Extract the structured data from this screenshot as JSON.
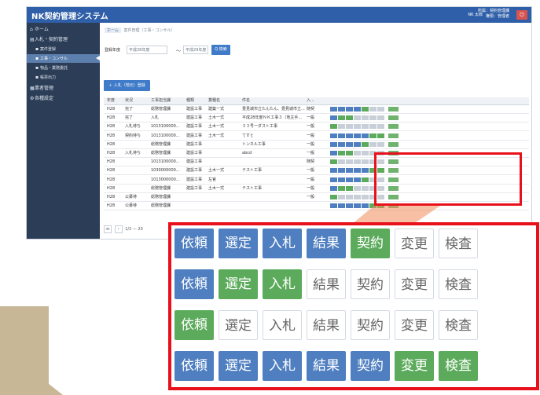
{
  "app": {
    "title": "NK契約管理システム",
    "user": "NK 太郎",
    "role_line1": "所属：契約管理課",
    "role_line2": "権限：管理者",
    "logout_label": "⏻"
  },
  "sidebar": {
    "items": [
      {
        "label": "ホーム",
        "icon": "home-icon"
      },
      {
        "label": "入札・契約管理",
        "icon": "list-icon"
      },
      {
        "label": "案件登録",
        "icon": "form-icon",
        "sub": true
      },
      {
        "label": "工事・コンサル",
        "icon": "form-icon",
        "sub": true,
        "active": true
      },
      {
        "label": "物品・業務委託",
        "icon": "form-icon",
        "sub": true
      },
      {
        "label": "帳票出力",
        "icon": "print-icon",
        "sub": true
      },
      {
        "label": "業者管理",
        "icon": "people-icon"
      },
      {
        "label": "各種設定",
        "icon": "gear-icon"
      }
    ]
  },
  "breadcrumb": {
    "home": "ホーム",
    "current": "案件管理（工事・コンサル）"
  },
  "filter": {
    "label": "登録年度",
    "from_placeholder": "平成28年度",
    "to_placeholder": "平成29年度",
    "separator": "〜",
    "search_label": "Q 検索"
  },
  "new_button": "＋ 入札（地元）登録",
  "table": {
    "headers": [
      "年度",
      "状況",
      "工事担当課",
      "種類",
      "業種名",
      "件名",
      "入...",
      ""
    ],
    "rows": [
      [
        "H28",
        "完了",
        "総務管理課",
        "建設工事",
        "建築一式",
        "豊見城市立たんたん、豊見城市立...",
        "随契"
      ],
      [
        "H28",
        "完了",
        "入札",
        "建設工事",
        "土木一式",
        "平成28年度ＮＫ工事３（地主手...",
        "一般"
      ],
      [
        "H28",
        "入札待ち",
        "1013100000...",
        "建設工事",
        "土木一式",
        "３３号ーダスト工事",
        "一般"
      ],
      [
        "H28",
        "契約待ち",
        "1013100000...",
        "建設工事",
        "土木一式",
        "てすと",
        "一般"
      ],
      [
        "H28",
        "",
        "総務管理課",
        "建設工事",
        "",
        "トンネル工事",
        "一般"
      ],
      [
        "H28",
        "入札待ち",
        "総務管理課",
        "建設工事",
        "",
        "abcd",
        "一般"
      ],
      [
        "H28",
        "",
        "1013100000...",
        "建設工事",
        "",
        "",
        "随契"
      ],
      [
        "H28",
        "",
        "1030000000...",
        "建設工事",
        "土木一式",
        "テスト工事",
        "一般"
      ],
      [
        "H28",
        "",
        "1013000000...",
        "建設工事",
        "左官",
        "",
        "一般"
      ],
      [
        "H28",
        "",
        "総務管理課",
        "建設工事",
        "土木一式",
        "テスト工事",
        "一般"
      ],
      [
        "H28",
        "公募待",
        "総務管理課",
        "",
        "",
        "",
        "一般"
      ],
      [
        "H28",
        "公募待",
        "総務管理課",
        "",
        "",
        "",
        ""
      ]
    ]
  },
  "pager": {
    "first": "≪",
    "prev": "‹",
    "range": "1/2 — 20"
  },
  "zoom": {
    "stages": [
      "依頼",
      "選定",
      "入札",
      "結果",
      "契約",
      "変更",
      "検査"
    ],
    "rows": [
      [
        "blue",
        "blue",
        "blue",
        "blue",
        "green",
        "white",
        "white"
      ],
      [
        "blue",
        "green",
        "green",
        "white",
        "white",
        "white",
        "white"
      ],
      [
        "green",
        "white",
        "white",
        "white",
        "white",
        "white",
        "white"
      ],
      [
        "blue",
        "blue",
        "blue",
        "blue",
        "blue",
        "green",
        "green"
      ]
    ]
  },
  "colors": {
    "header_blue": "#2f5fa8",
    "sidebar": "#2c3e57",
    "stage_blue": "#4f7fc1",
    "stage_green": "#5cab5c",
    "highlight_red": "#e8111b"
  }
}
